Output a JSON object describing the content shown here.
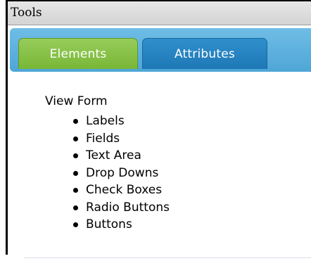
{
  "window": {
    "title": "Tools"
  },
  "tabs": [
    {
      "label": "Elements",
      "active": true,
      "color": "#85c147"
    },
    {
      "label": "Attributes",
      "active": false,
      "color": "#2a85c4"
    }
  ],
  "content": {
    "heading": "View Form",
    "items": [
      "Labels",
      "Fields",
      "Text Area",
      "Drop Downs",
      "Check Boxes",
      "Radio Buttons",
      "Buttons"
    ]
  },
  "colors": {
    "tabstrip": "#5bb1de",
    "titlebar": "#dcdcdc"
  }
}
